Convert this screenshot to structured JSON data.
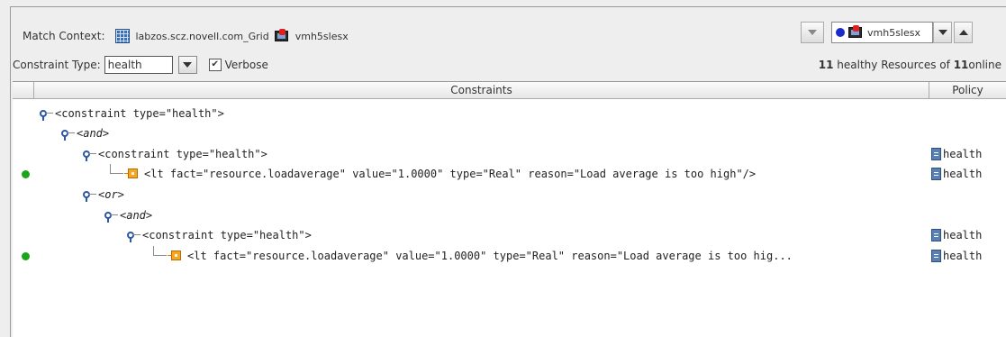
{
  "match_context": {
    "label": "Match Context:",
    "grid_name": "labzos.scz.novell.com_Grid",
    "resource_name": "vmh5slesx"
  },
  "resource_selector": {
    "value": "vmh5slesx"
  },
  "constraint_type": {
    "label": "Constraint Type:",
    "value": "health"
  },
  "verbose": {
    "label": "Verbose",
    "checked": true,
    "check_glyph": "✔"
  },
  "summary": {
    "healthy_count": "11",
    "middle_text": " healthy Resources of ",
    "online_count": "11",
    "end_text": " online"
  },
  "table": {
    "columns": [
      "Constraints",
      "Policy"
    ],
    "rows": [
      {
        "text": "<constraint type=\"health\">",
        "italic": false,
        "policy": "",
        "status": ""
      },
      {
        "text": "<and>",
        "italic": true,
        "policy": "",
        "status": ""
      },
      {
        "text": "<constraint type=\"health\">",
        "italic": false,
        "policy": "health",
        "status": ""
      },
      {
        "text": "<lt fact=\"resource.loadaverage\" value=\"1.0000\" type=\"Real\" reason=\"Load average is too high\"/>",
        "italic": false,
        "policy": "health",
        "status": "green"
      },
      {
        "text": "<or>",
        "italic": true,
        "policy": "",
        "status": ""
      },
      {
        "text": "<and>",
        "italic": true,
        "policy": "",
        "status": ""
      },
      {
        "text": "<constraint type=\"health\">",
        "italic": false,
        "policy": "health",
        "status": ""
      },
      {
        "text": "<lt fact=\"resource.loadaverage\" value=\"1.0000\" type=\"Real\" reason=\"Load average is too hig...",
        "italic": false,
        "policy": "health",
        "status": "green"
      }
    ]
  },
  "icons": {
    "grid": "grid-icon",
    "host": "host-icon",
    "status_ok": "green-dot-icon",
    "policy": "policy-document-icon",
    "branch": "tree-node-icon",
    "leaf": "fact-leaf-icon",
    "selected_resource": "blue-dot-icon"
  },
  "colors": {
    "status_ok": "#1aa51a",
    "selected_dot": "#1a2cc8",
    "leaf": "#f5a623"
  }
}
